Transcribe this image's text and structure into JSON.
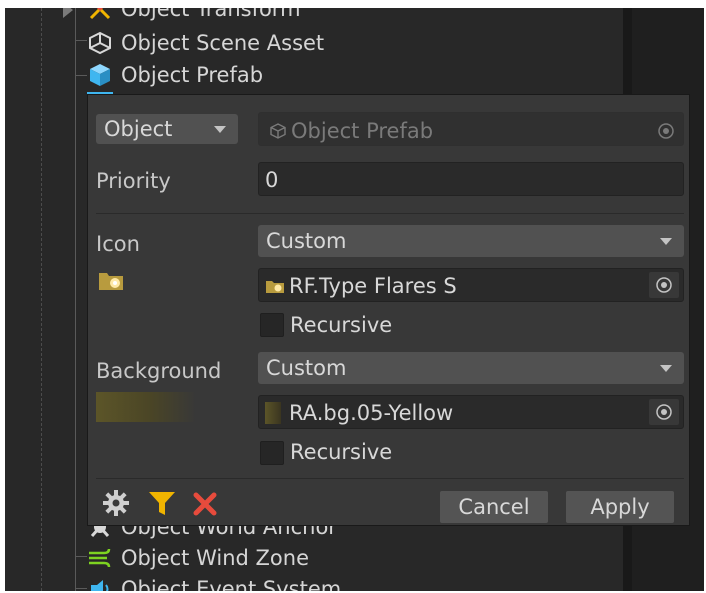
{
  "hierarchy": {
    "items": [
      {
        "label": "Object Transform",
        "icon": "transform-gizmo-icon"
      },
      {
        "label": "Object Scene Asset",
        "icon": "unity-scene-icon"
      },
      {
        "label": "Object Prefab",
        "icon": "prefab-cube-icon"
      },
      {
        "label": "Object World Anchor",
        "icon": "world-anchor-icon"
      },
      {
        "label": "Object Wind Zone",
        "icon": "wind-zone-icon"
      },
      {
        "label": "Object Event System",
        "icon": "event-system-icon"
      }
    ]
  },
  "popup": {
    "type_select": "Object",
    "object_field": "Object Prefab",
    "priority_label": "Priority",
    "priority_value": "0",
    "icon_label": "Icon",
    "icon_mode": "Custom",
    "icon_asset": "RF.Type Flares S",
    "icon_recursive": "Recursive",
    "background_label": "Background",
    "background_mode": "Custom",
    "background_asset": "RA.bg.05-Yellow",
    "background_recursive": "Recursive",
    "cancel_label": "Cancel",
    "apply_label": "Apply"
  },
  "colors": {
    "accent_yellow": "#f0b400",
    "delete_red": "#e74b3c",
    "prefab_blue": "#3fb6f0",
    "background_swatch": "#5c5528"
  }
}
